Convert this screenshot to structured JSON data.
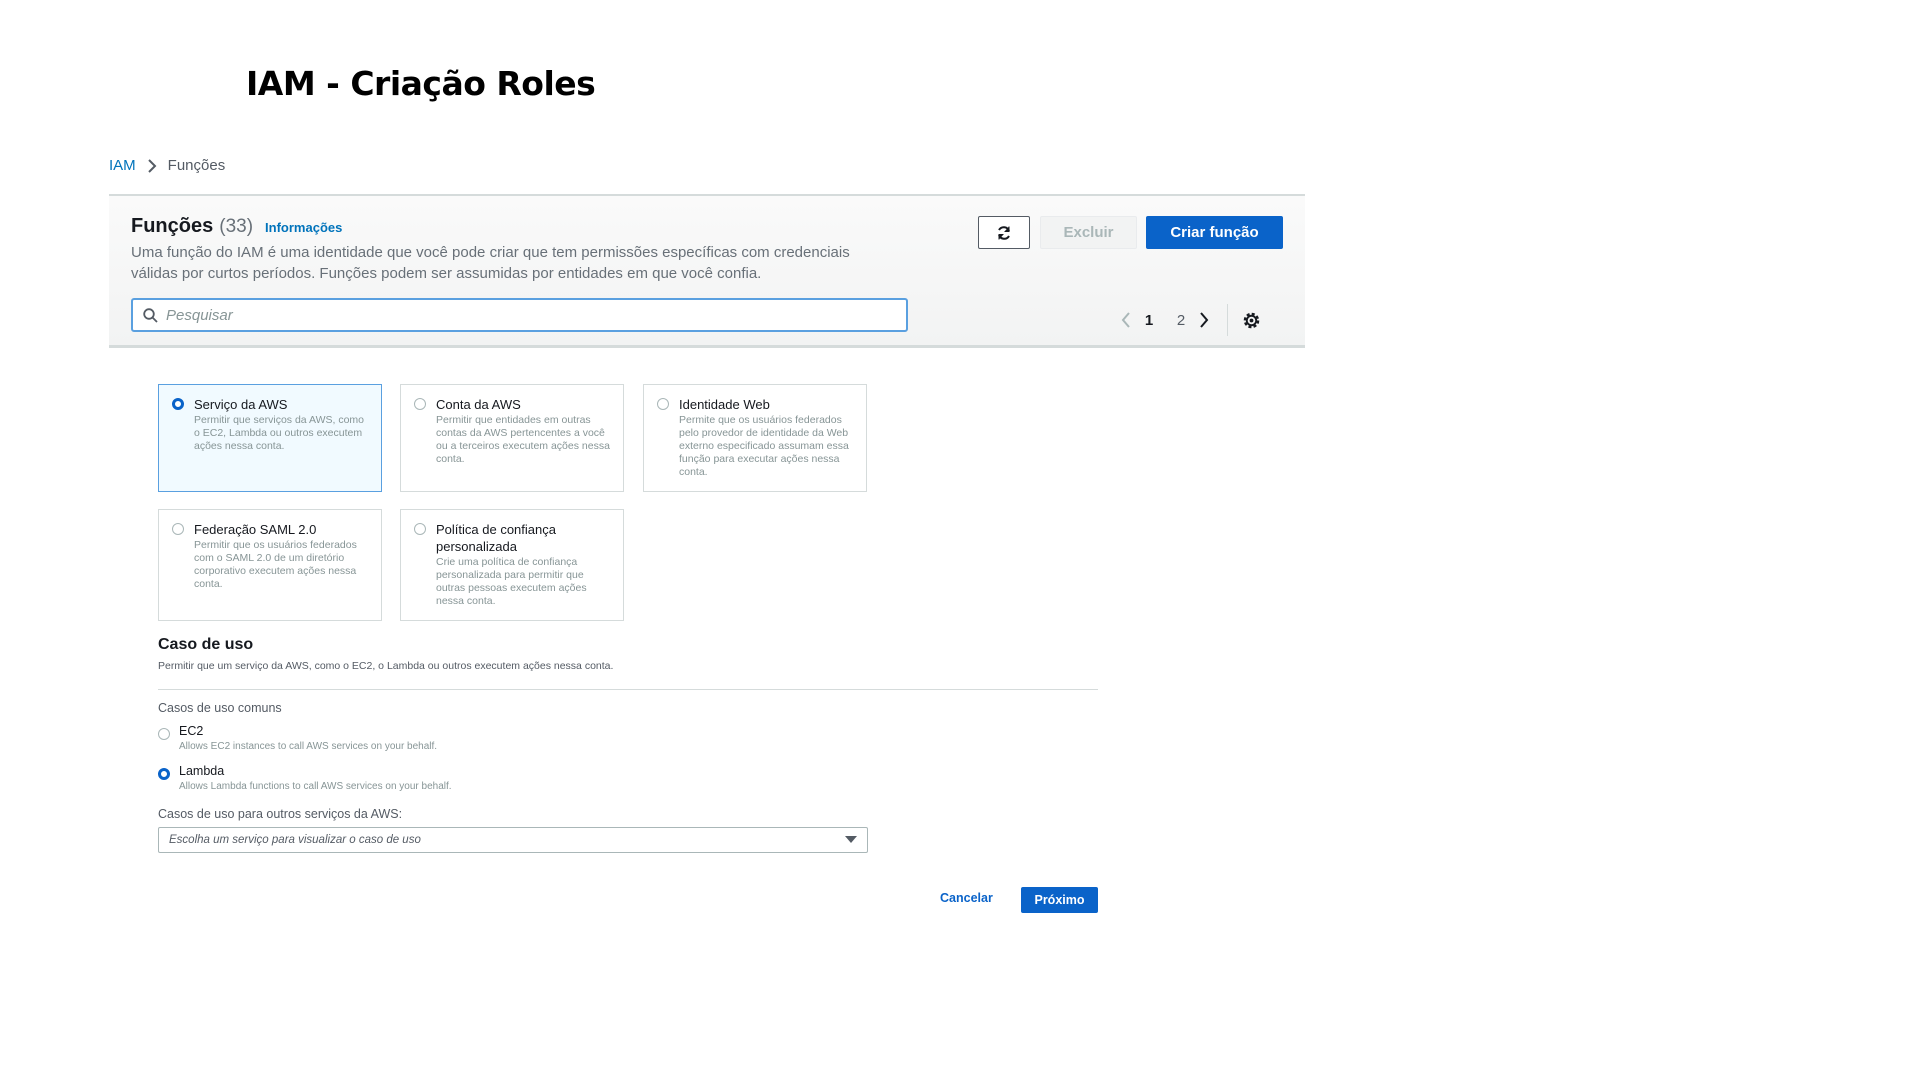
{
  "slide_title": "IAM - Criação Roles",
  "breadcrumb": {
    "root": "IAM",
    "current": "Funções"
  },
  "panel": {
    "title": "Funções",
    "count": "(33)",
    "info_link": "Informações",
    "description": "Uma função do IAM é uma identidade que você pode criar que tem permissões específicas com credenciais válidas por curtos períodos. Funções podem ser assumidas por entidades em que você confia.",
    "buttons": {
      "delete": "Excluir",
      "create": "Criar função"
    },
    "search_placeholder": "Pesquisar",
    "pagination": {
      "pages": [
        "1",
        "2"
      ],
      "current": "1"
    }
  },
  "entity_types": [
    {
      "title": "Serviço da AWS",
      "description": "Permitir que serviços da AWS, como o EC2, Lambda ou outros executem ações nessa conta.",
      "selected": true
    },
    {
      "title": "Conta da AWS",
      "description": "Permitir que entidades em outras contas da AWS pertencentes a você ou a terceiros executem ações nessa conta.",
      "selected": false
    },
    {
      "title": "Identidade Web",
      "description": "Permite que os usuários federados pelo provedor de identidade da Web externo especificado assumam essa função para executar ações nessa conta.",
      "selected": false
    },
    {
      "title": "Federação SAML 2.0",
      "description": "Permitir que os usuários federados com o SAML 2.0 de um diretório corporativo executem ações nessa conta.",
      "selected": false
    },
    {
      "title": "Política de confiança personalizada",
      "description": "Crie uma política de confiança personalizada para permitir que outras pessoas executem ações nessa conta.",
      "selected": false
    }
  ],
  "use_case": {
    "title": "Caso de uso",
    "description": "Permitir que um serviço da AWS, como o EC2, o Lambda ou outros executem ações nessa conta.",
    "common_label": "Casos de uso comuns",
    "options": [
      {
        "label": "EC2",
        "description": "Allows EC2 instances to call AWS services on your behalf.",
        "selected": false
      },
      {
        "label": "Lambda",
        "description": "Allows Lambda functions to call AWS services on your behalf.",
        "selected": true
      }
    ],
    "other_label": "Casos de uso para outros serviços da AWS:",
    "select_placeholder": "Escolha um serviço para visualizar o caso de uso"
  },
  "footer": {
    "cancel": "Cancelar",
    "next": "Próximo"
  },
  "colors": {
    "primary": "#0a63c9",
    "link": "#0073bb",
    "selected_bg": "#f1faff",
    "selected_border": "#5aa0e0"
  },
  "icons": [
    "chevron-right-icon",
    "refresh-icon",
    "search-icon",
    "chevron-left-icon",
    "settings-icon",
    "caret-down-icon"
  ]
}
